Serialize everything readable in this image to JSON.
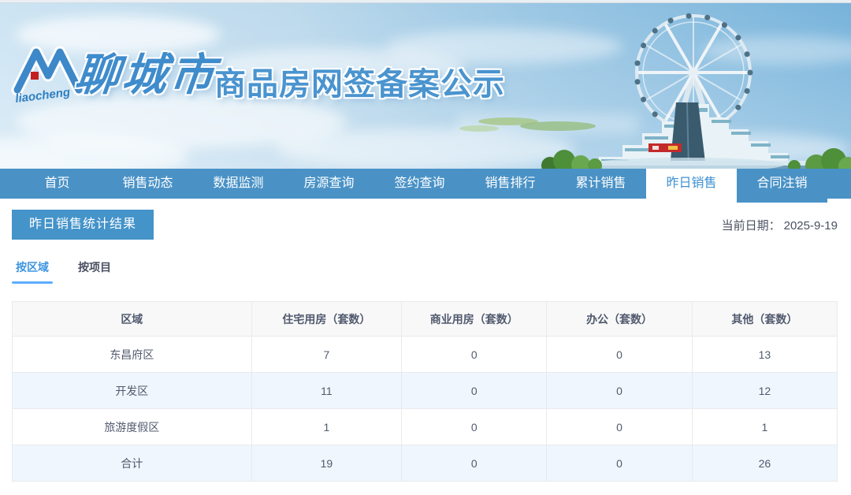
{
  "banner": {
    "logo_script": "liaocheng",
    "site_name": "聊城市",
    "site_title": "商品房网签备案公示"
  },
  "nav": {
    "items": [
      {
        "label": "首页",
        "active": false
      },
      {
        "label": "销售动态",
        "active": false
      },
      {
        "label": "数据监测",
        "active": false
      },
      {
        "label": "房源查询",
        "active": false
      },
      {
        "label": "签约查询",
        "active": false
      },
      {
        "label": "销售排行",
        "active": false
      },
      {
        "label": "累计销售",
        "active": false
      },
      {
        "label": "昨日销售",
        "active": true
      },
      {
        "label": "合同注销",
        "active": false
      }
    ]
  },
  "page": {
    "section_title": "昨日销售统计结果",
    "date_label": "当前日期：",
    "date_value": "2025-9-19",
    "tabs": [
      {
        "label": "按区域",
        "active": true
      },
      {
        "label": "按项目",
        "active": false
      }
    ]
  },
  "table": {
    "headers": [
      "区域",
      "住宅用房（套数）",
      "商业用房（套数）",
      "办公（套数）",
      "其他（套数）"
    ],
    "rows": [
      [
        "东昌府区",
        "7",
        "0",
        "0",
        "13"
      ],
      [
        "开发区",
        "11",
        "0",
        "0",
        "12"
      ],
      [
        "旅游度假区",
        "1",
        "0",
        "0",
        "1"
      ],
      [
        "合计",
        "19",
        "0",
        "0",
        "26"
      ]
    ]
  },
  "colors": {
    "nav_blue": "#4a92c6",
    "badge_blue": "#4493c9",
    "nav_active_text": "#3e90d1",
    "tab_active": "#3d95e0",
    "tab_underline": "#5cadff",
    "row_alt_bg": "#eff6fd",
    "table_border": "#e8eaec",
    "header_bg": "#f8f8f9",
    "text_dark": "#495060",
    "title_blue": "#4a94cf",
    "logo_red": "#c41f1f"
  }
}
